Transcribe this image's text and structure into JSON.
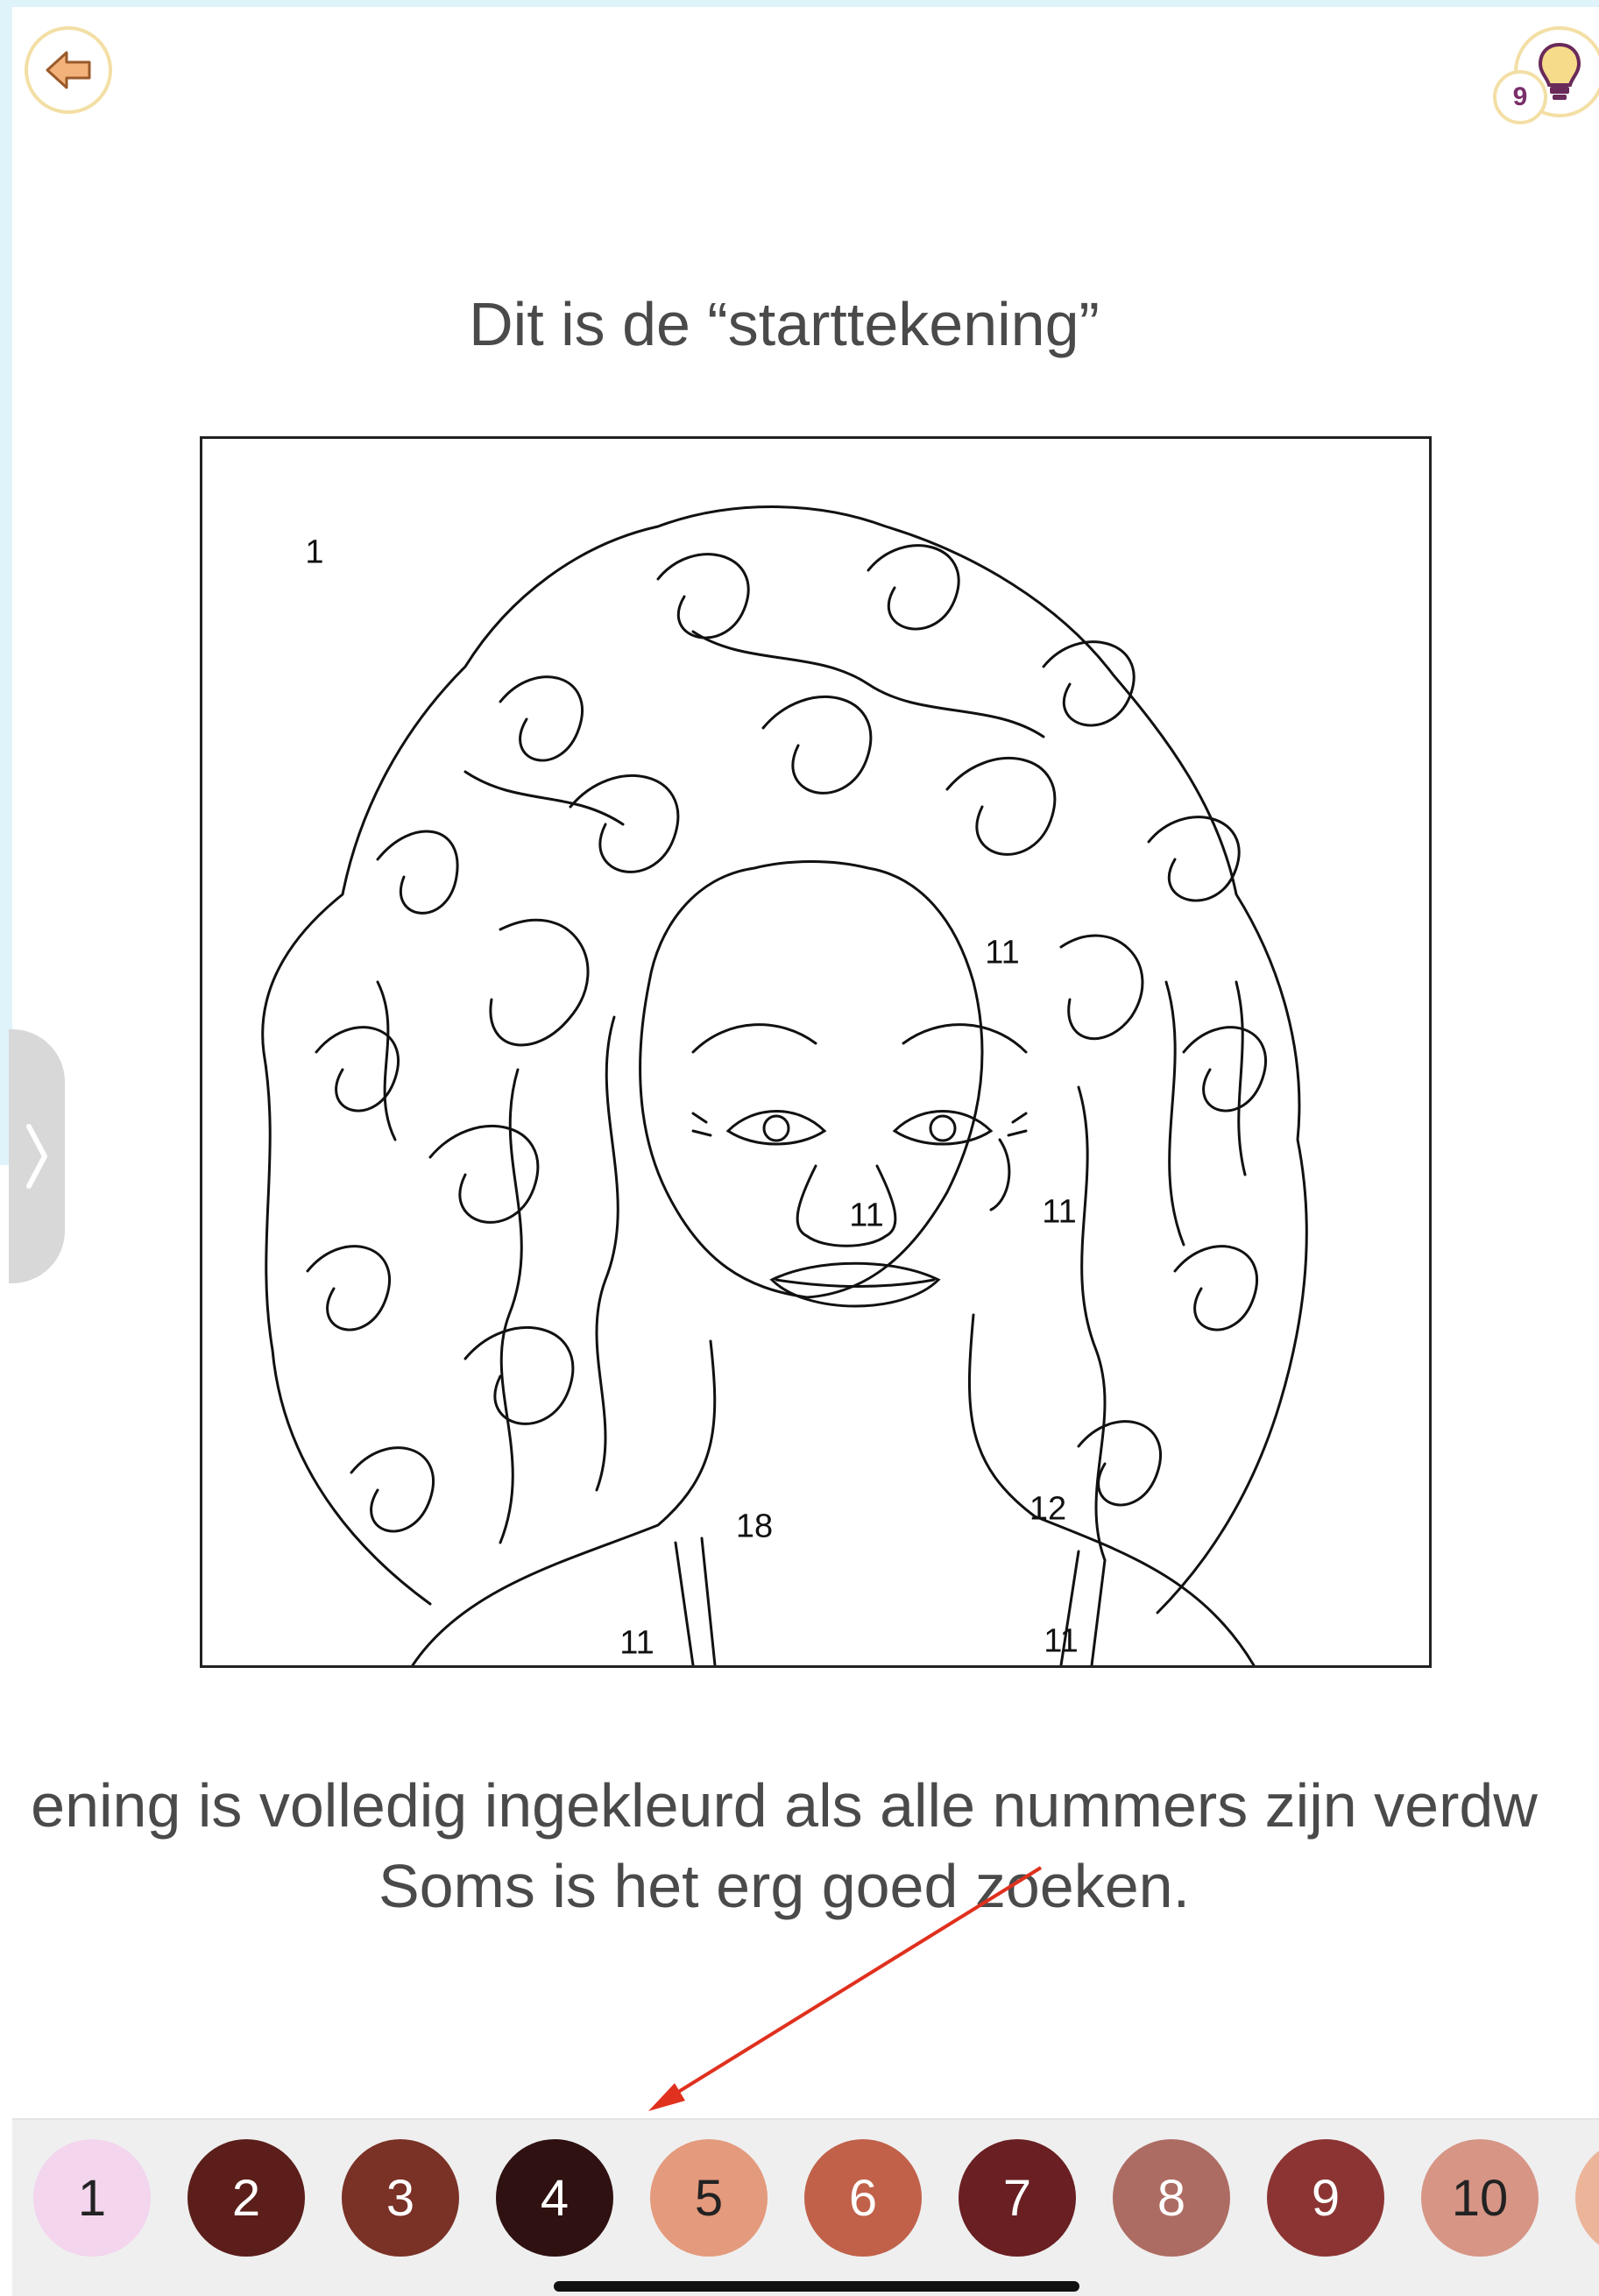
{
  "header": {
    "back_icon": "arrow-left-icon",
    "hint_icon": "lightbulb-icon",
    "hint_count": "9"
  },
  "tutorial": {
    "heading": "Dit is de “starttekening”",
    "instruction_line1": "ening is volledig ingekleurd als alle nummers zijn verdw",
    "instruction_line2": "Soms is het erg goed zoeken."
  },
  "drawing": {
    "region_numbers": [
      "1",
      "11",
      "11",
      "11",
      "18",
      "12",
      "11",
      "11"
    ]
  },
  "palette": {
    "colors": [
      {
        "label": "1",
        "color": "#f3d5ee",
        "text_color": "#222222"
      },
      {
        "label": "2",
        "color": "#5b1e1a",
        "text_color": "#ffffff"
      },
      {
        "label": "3",
        "color": "#7a3126",
        "text_color": "#ffffff"
      },
      {
        "label": "4",
        "color": "#2e1110",
        "text_color": "#ffffff"
      },
      {
        "label": "5",
        "color": "#e49a7c",
        "text_color": "#222222"
      },
      {
        "label": "6",
        "color": "#c1614a",
        "text_color": "#ffffff"
      },
      {
        "label": "7",
        "color": "#6a1f22",
        "text_color": "#ffffff"
      },
      {
        "label": "8",
        "color": "#ad6c63",
        "text_color": "#ffffff"
      },
      {
        "label": "9",
        "color": "#8c3434",
        "text_color": "#ffffff"
      },
      {
        "label": "10",
        "color": "#d79586",
        "text_color": "#222222"
      }
    ],
    "partial_color": "#ecb59a"
  },
  "colors": {
    "accent_border": "#f3dfa5",
    "back_arrow": "#f2b27a",
    "hint_bulb": "#f6dc8a",
    "annotation_arrow": "#e0301e"
  }
}
